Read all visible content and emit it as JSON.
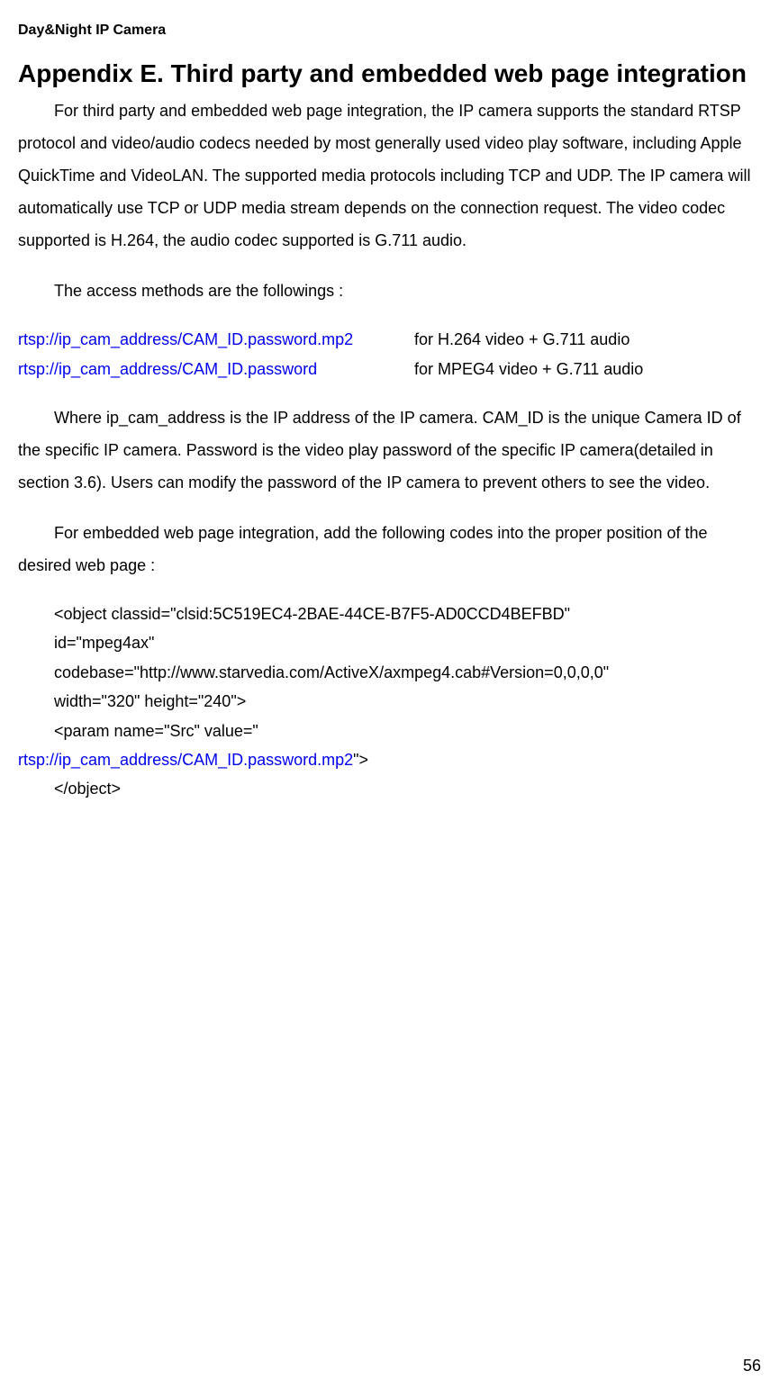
{
  "header": {
    "title": "Day&Night IP Camera"
  },
  "heading": "Appendix E. Third party and embedded web page integration",
  "para1": "For third party and embedded web page integration, the IP camera supports the standard RTSP protocol and video/audio codecs needed by most generally used video play software, including Apple QuickTime and VideoLAN. The supported media protocols including TCP and UDP. The IP camera will automatically use TCP or UDP media stream depends on the connection request. The video codec supported is H.264, the audio codec supported is G.711 audio.",
  "para2": "The access methods are the followings :",
  "rtsp_rows": [
    {
      "url": "rtsp://ip_cam_address/CAM_ID.password.mp2",
      "desc": "for H.264 video + G.711 audio"
    },
    {
      "url": "rtsp://ip_cam_address/CAM_ID.password",
      "desc": "for MPEG4 video + G.711 audio"
    }
  ],
  "para3": "Where ip_cam_address is the IP address of the IP camera. CAM_ID is the unique Camera ID of the specific IP camera. Password is the video play password of the specific IP camera(detailed in section 3.6). Users can modify the password of the IP camera to prevent others to see the video.",
  "para4": "For embedded web page integration, add the following codes into the proper position of the desired web page :",
  "code_lines": [
    "<object classid=\"clsid:5C519EC4-2BAE-44CE-B7F5-AD0CCD4BEFBD\"",
    "id=\"mpeg4ax\"",
    "codebase=\"http://www.starvedia.com/ActiveX/axmpeg4.cab#Version=0,0,0,0\"",
    "width=\"320\" height=\"240\">",
    "<param name=\"Src\" value=\""
  ],
  "code_link": "rtsp://ip_cam_address/CAM_ID.password.mp2",
  "code_link_suffix": "\">",
  "code_close": "</object>",
  "page_number": "56"
}
